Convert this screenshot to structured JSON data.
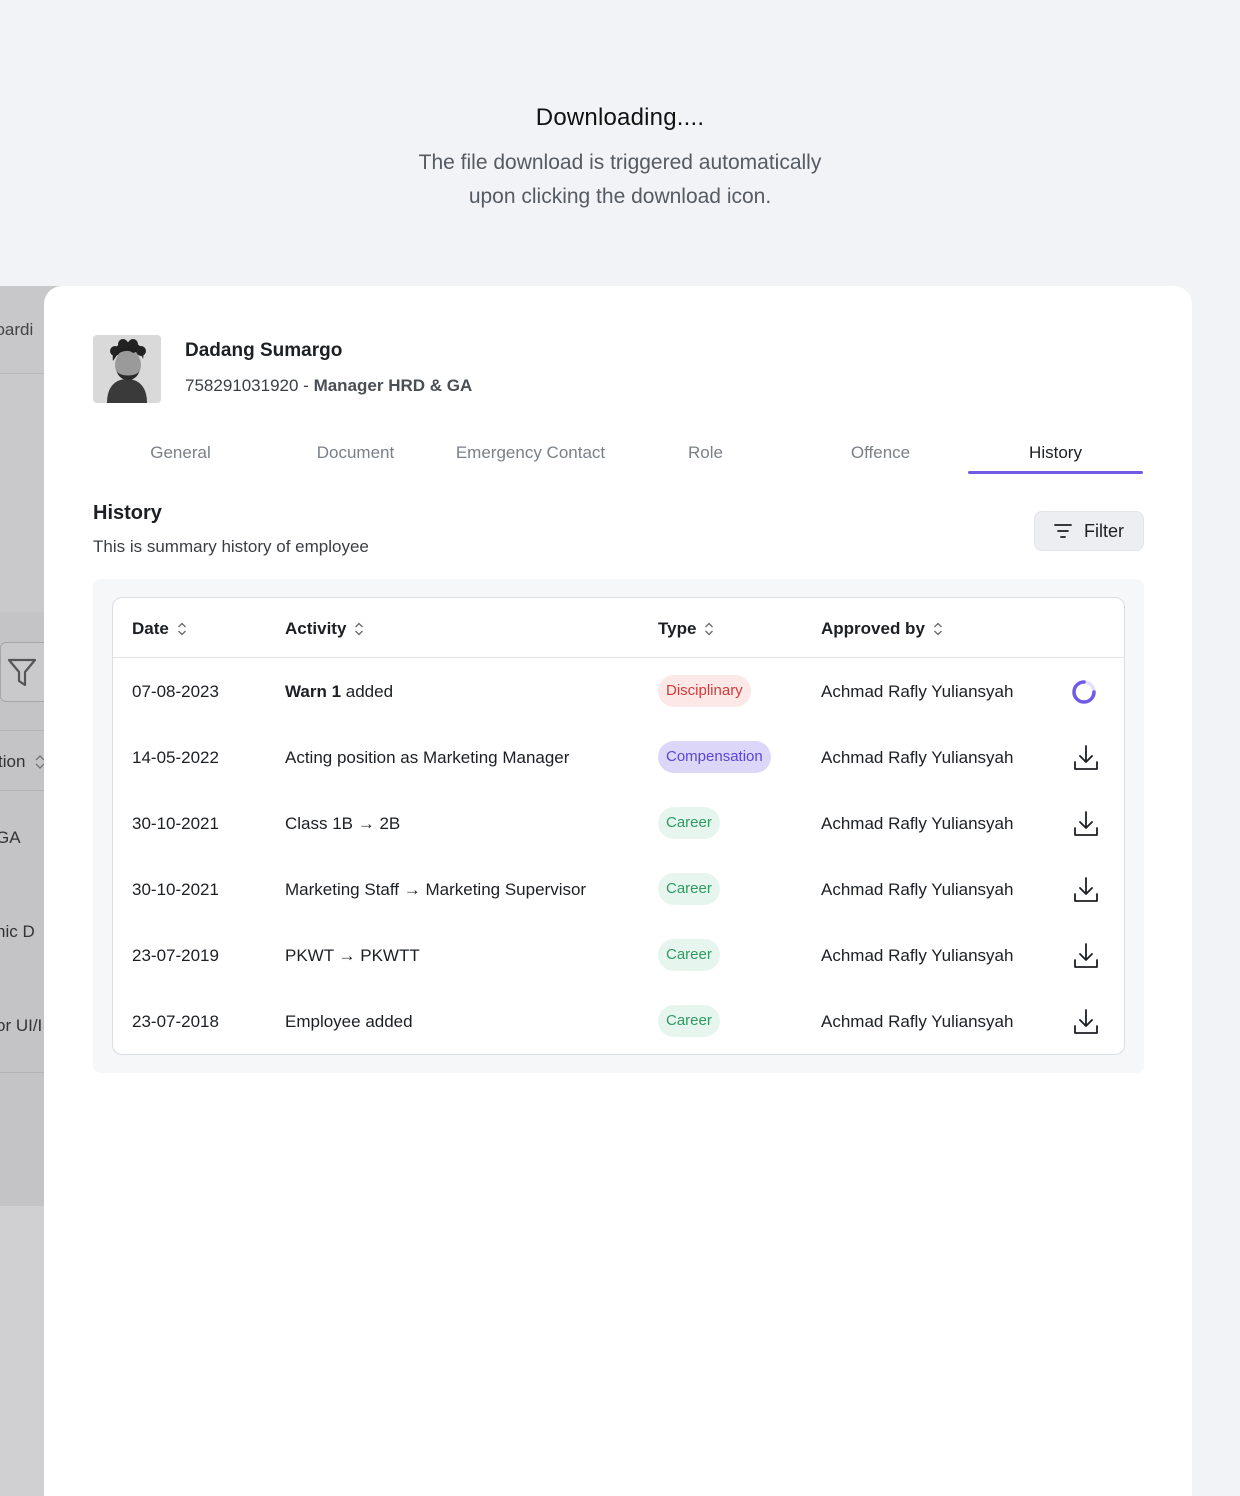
{
  "caption": {
    "title": "Downloading....",
    "line1": "The file download is triggered automatically",
    "line2": "upon clicking the download icon."
  },
  "background": {
    "top_text": "boardi",
    "texts": [
      "tion",
      "GA",
      "hic D",
      "or UI/I"
    ]
  },
  "employee": {
    "name": "Dadang Sumargo",
    "id": "758291031920 - ",
    "position": "Manager HRD & GA"
  },
  "tabs": [
    {
      "label": "General",
      "active": false
    },
    {
      "label": "Document",
      "active": false
    },
    {
      "label": "Emergency Contact",
      "active": false
    },
    {
      "label": "Role",
      "active": false
    },
    {
      "label": "Offence",
      "active": false
    },
    {
      "label": "History",
      "active": true
    }
  ],
  "section": {
    "title": "History",
    "subtitle": "This is summary history of employee",
    "filter_label": "Filter"
  },
  "table": {
    "headers": {
      "date": "Date",
      "activity": "Activity",
      "type": "Type",
      "approved": "Approved by"
    },
    "rows": [
      {
        "date": "07-08-2023",
        "activity_bold": "Warn 1",
        "activity": " added",
        "type": "Disciplinary",
        "type_color": "red",
        "approved": "Achmad Rafly Yuliansyah",
        "status": "loading"
      },
      {
        "date": "14-05-2022",
        "activity_bold": "",
        "activity": "Acting position as Marketing Manager",
        "type": "Compensation",
        "type_color": "purple",
        "approved": "Achmad Rafly Yuliansyah",
        "status": "download"
      },
      {
        "date": "30-10-2021",
        "activity_bold": "",
        "activity": "Class 1B → 2B",
        "type": "Career",
        "type_color": "green",
        "approved": "Achmad Rafly Yuliansyah",
        "status": "download"
      },
      {
        "date": "30-10-2021",
        "activity_bold": "",
        "activity": "Marketing Staff → Marketing Supervisor",
        "type": "Career",
        "type_color": "green",
        "approved": "Achmad Rafly Yuliansyah",
        "status": "download"
      },
      {
        "date": "23-07-2019",
        "activity_bold": "",
        "activity": "PKWT → PKWTT",
        "type": "Career",
        "type_color": "green",
        "approved": "Achmad Rafly Yuliansyah",
        "status": "download"
      },
      {
        "date": "23-07-2018",
        "activity_bold": "",
        "activity": "Employee added",
        "type": "Career",
        "type_color": "green",
        "approved": "Achmad Rafly Yuliansyah",
        "status": "download"
      }
    ]
  },
  "colors": {
    "accent": "#6f5be6",
    "badge_red": "#d43a3a",
    "badge_purple": "#5b45d6",
    "badge_green": "#2e9a62"
  }
}
